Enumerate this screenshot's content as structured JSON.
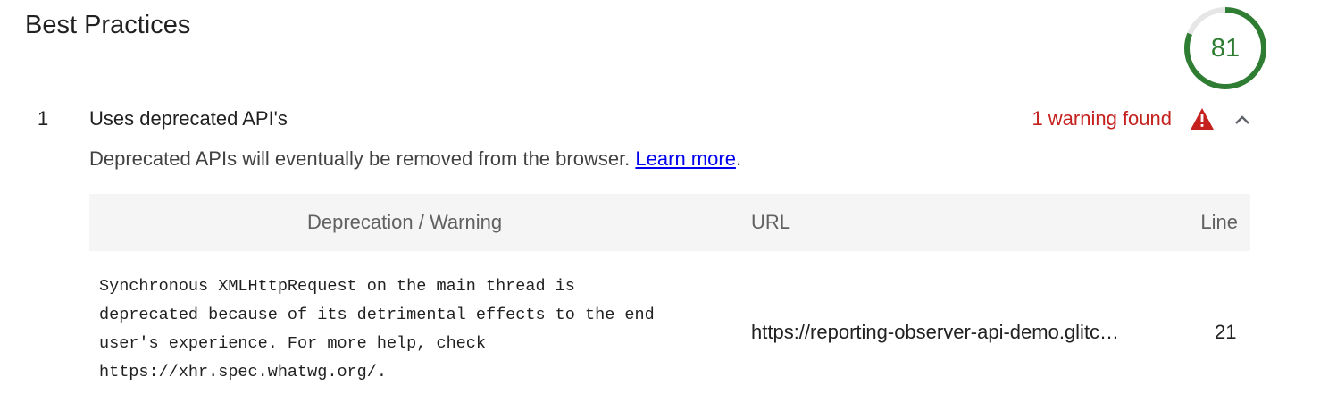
{
  "category": {
    "title": "Best Practices",
    "score": "81",
    "score_fraction": 0.81,
    "score_color": "#2e7d32",
    "track_color": "#e6e6e6"
  },
  "audit": {
    "index": "1",
    "title": "Uses deprecated API's",
    "status": "1 warning found",
    "status_color": "#c5221f",
    "status_icon": "warning-triangle-icon",
    "toggle_icon": "chevron-up-icon",
    "description_text": "Deprecated APIs will eventually be removed from the browser.",
    "learn_more": "Learn more",
    "description_end": "."
  },
  "table": {
    "headers": [
      "Deprecation / Warning",
      "URL",
      "Line"
    ],
    "rows": [
      {
        "deprecation": "Synchronous XMLHttpRequest on the main thread is\ndeprecated because of its detrimental effects to the end\nuser's experience. For more help, check\nhttps://xhr.spec.whatwg.org/.",
        "url": "https://reporting-observer-api-demo.glitc…",
        "line": "21"
      }
    ]
  }
}
